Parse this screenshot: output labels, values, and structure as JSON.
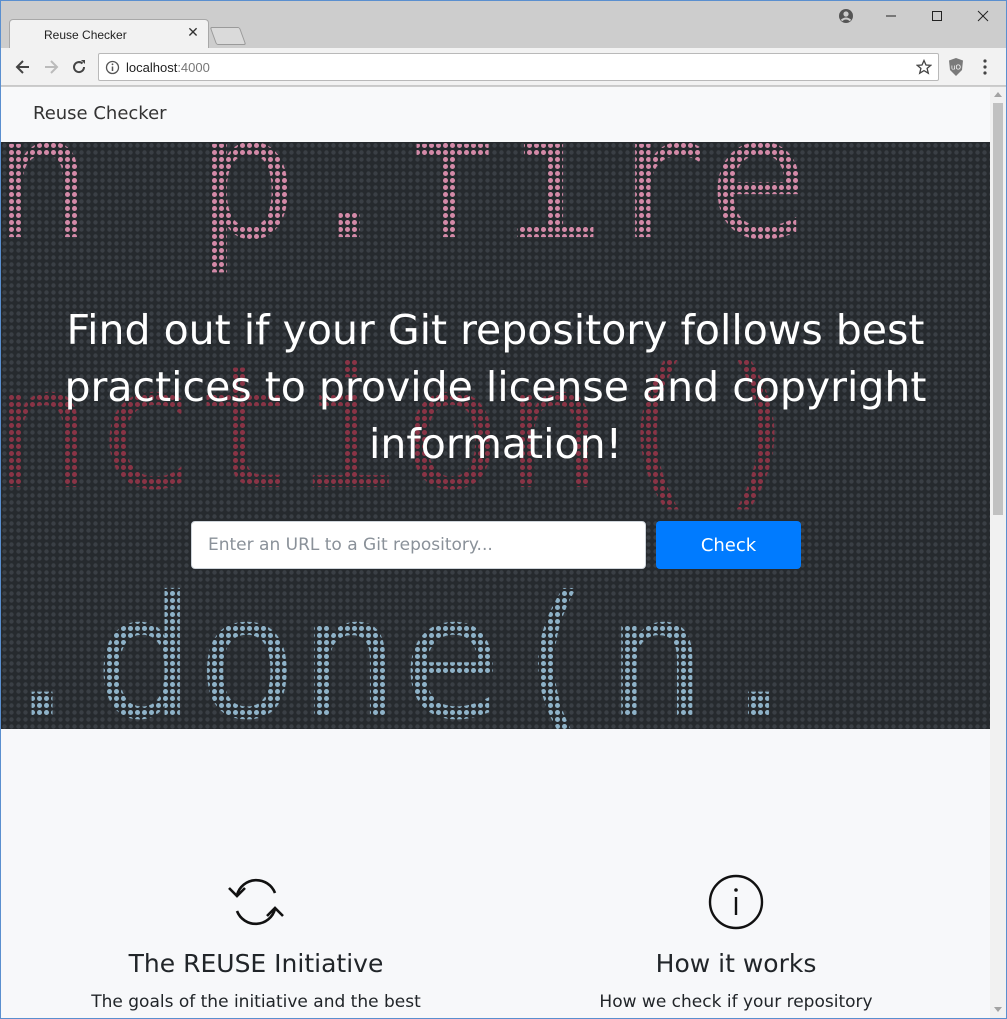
{
  "browser": {
    "tab_title": "Reuse Checker",
    "url_host": "localhost",
    "url_port": ":4000"
  },
  "navbar": {
    "brand": "Reuse Checker"
  },
  "hero": {
    "title": "Find out if your Git repository follows best practices to provide license and copyright information!",
    "input_placeholder": "Enter an URL to a Git repository...",
    "check_label": "Check",
    "background_code_lines": [
      "n p.fire",
      "nction()",
      ".done(n."
    ]
  },
  "features": [
    {
      "icon": "refresh-icon",
      "title": "The REUSE Initiative",
      "text": "The goals of the initiative and the best"
    },
    {
      "icon": "info-icon",
      "title": "How it works",
      "text": "How we check if your repository"
    }
  ],
  "colors": {
    "accent": "#007bff",
    "hero_bg": "#262a2e",
    "page_bg": "#f7f8fa"
  }
}
